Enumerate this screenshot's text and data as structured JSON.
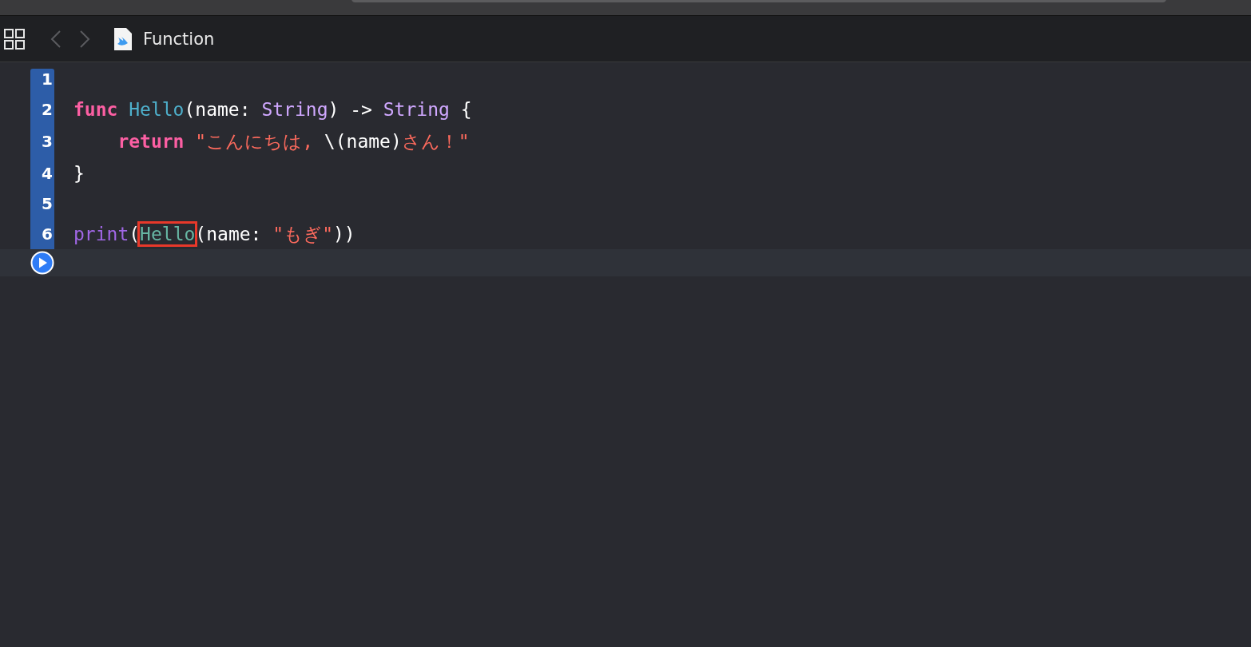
{
  "toolbar": {
    "title": "Function"
  },
  "lines": [
    {
      "number": "1"
    },
    {
      "number": "2",
      "tokens": [
        {
          "kind": "keyword",
          "text": "func"
        },
        {
          "kind": "decl",
          "text": "Hello",
          "space_before": true
        },
        {
          "kind": "plain",
          "text": "(name: "
        },
        {
          "kind": "type",
          "text": "String"
        },
        {
          "kind": "plain",
          "text": ") -> "
        },
        {
          "kind": "type",
          "text": "String"
        },
        {
          "kind": "plain",
          "text": "{",
          "space_before": true
        }
      ]
    },
    {
      "number": "3",
      "indented": true,
      "tokens": [
        {
          "kind": "keyword",
          "text": "return"
        },
        {
          "kind": "string",
          "text": "\"こんにちは, ",
          "space_before": true
        },
        {
          "kind": "plain",
          "text": "\\(name)"
        },
        {
          "kind": "string",
          "text": "さん！\""
        }
      ]
    },
    {
      "number": "4",
      "tokens": [
        {
          "kind": "plain",
          "text": "}"
        }
      ]
    },
    {
      "number": "5"
    },
    {
      "number": "6",
      "tokens": [
        {
          "kind": "builtin",
          "text": "print"
        },
        {
          "kind": "plain",
          "text": "("
        },
        {
          "kind": "call",
          "text": "Hello",
          "highlighted": true
        },
        {
          "kind": "plain",
          "text": "(name: "
        },
        {
          "kind": "string",
          "text": "\"もぎ\""
        },
        {
          "kind": "plain",
          "text": "))"
        }
      ]
    }
  ]
}
